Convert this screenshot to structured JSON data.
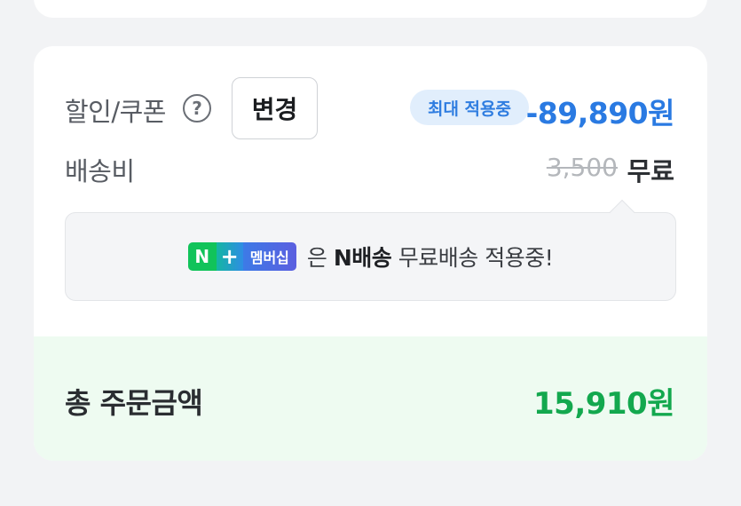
{
  "discount": {
    "label": "할인/쿠폰",
    "help_icon": "?",
    "change_button": "변경",
    "badge": "최대 적용중",
    "amount": "-89,890원"
  },
  "shipping": {
    "label": "배송비",
    "original_price": "3,500",
    "final": "무료"
  },
  "notice": {
    "badge_n": "N",
    "badge_plus": "+",
    "badge_label": "멤버십",
    "text_prefix": "은",
    "text_bold": "N배송",
    "text_suffix": "무료배송 적용중!"
  },
  "total": {
    "label": "총 주문금액",
    "amount": "15,910원"
  },
  "colors": {
    "accent_blue": "#2a7ae2",
    "total_green": "#13a84e",
    "membership_green": "#11c35a"
  }
}
